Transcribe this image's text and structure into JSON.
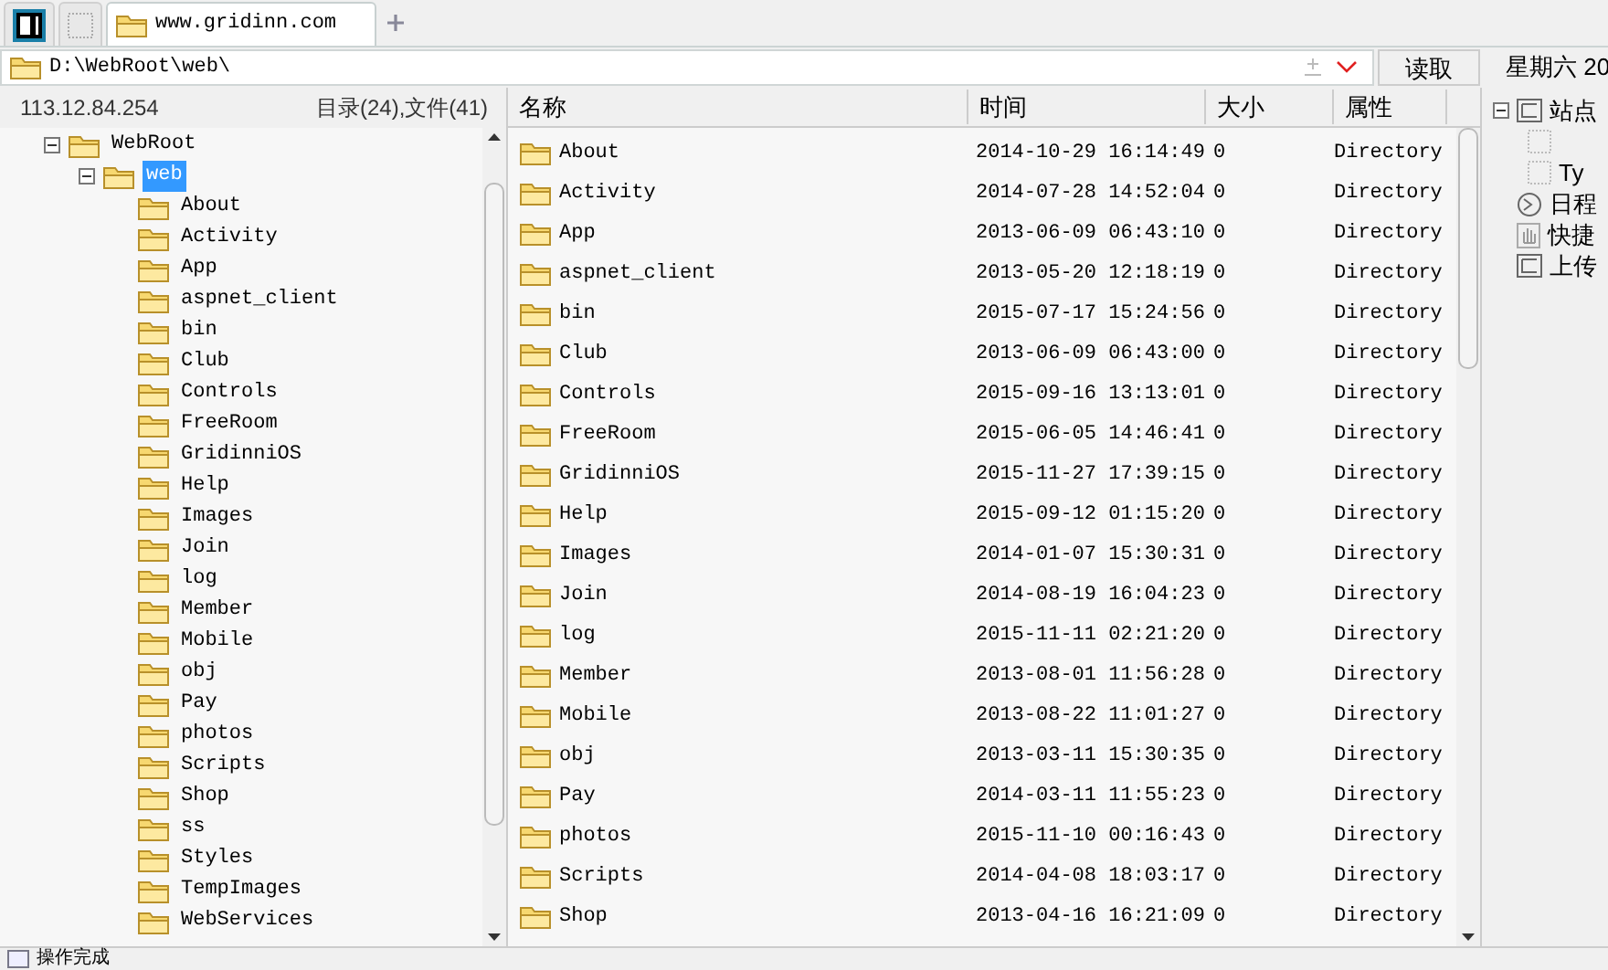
{
  "tabs": [
    {
      "kind": "panel",
      "selected": false
    },
    {
      "kind": "blank",
      "selected": false
    },
    {
      "kind": "site",
      "label": "www.gridinn.com",
      "selected": true
    }
  ],
  "address": {
    "value": "D:\\WebRoot\\web\\",
    "button": "读取"
  },
  "date": "星期六 20",
  "left_header": {
    "host": "113.12.84.254",
    "summary": "目录(24),文件(41)"
  },
  "tree": [
    {
      "label": "WebRoot",
      "expanded": true,
      "selected": false,
      "children": [
        {
          "label": "web",
          "expanded": true,
          "selected": true,
          "children": [
            {
              "label": "About"
            },
            {
              "label": "Activity"
            },
            {
              "label": "App"
            },
            {
              "label": "aspnet_client"
            },
            {
              "label": "bin"
            },
            {
              "label": "Club"
            },
            {
              "label": "Controls"
            },
            {
              "label": "FreeRoom"
            },
            {
              "label": "GridinniOS"
            },
            {
              "label": "Help"
            },
            {
              "label": "Images"
            },
            {
              "label": "Join"
            },
            {
              "label": "log"
            },
            {
              "label": "Member"
            },
            {
              "label": "Mobile"
            },
            {
              "label": "obj"
            },
            {
              "label": "Pay"
            },
            {
              "label": "photos"
            },
            {
              "label": "Scripts"
            },
            {
              "label": "Shop"
            },
            {
              "label": "ss"
            },
            {
              "label": "Styles"
            },
            {
              "label": "TempImages"
            },
            {
              "label": "WebServices"
            }
          ]
        }
      ]
    }
  ],
  "table": {
    "columns": [
      "名称",
      "时间",
      "大小",
      "属性"
    ],
    "rows": [
      [
        "About",
        "2014-10-29 16:14:49",
        "0",
        "Directory"
      ],
      [
        "Activity",
        "2014-07-28 14:52:04",
        "0",
        "Directory"
      ],
      [
        "App",
        "2013-06-09 06:43:10",
        "0",
        "Directory"
      ],
      [
        "aspnet_client",
        "2013-05-20 12:18:19",
        "0",
        "Directory"
      ],
      [
        "bin",
        "2015-07-17 15:24:56",
        "0",
        "Directory"
      ],
      [
        "Club",
        "2013-06-09 06:43:00",
        "0",
        "Directory"
      ],
      [
        "Controls",
        "2015-09-16 13:13:01",
        "0",
        "Directory"
      ],
      [
        "FreeRoom",
        "2015-06-05 14:46:41",
        "0",
        "Directory"
      ],
      [
        "GridinniOS",
        "2015-11-27 17:39:15",
        "0",
        "Directory"
      ],
      [
        "Help",
        "2015-09-12 01:15:20",
        "0",
        "Directory"
      ],
      [
        "Images",
        "2014-01-07 15:30:31",
        "0",
        "Directory"
      ],
      [
        "Join",
        "2014-08-19 16:04:23",
        "0",
        "Directory"
      ],
      [
        "log",
        "2015-11-11 02:21:20",
        "0",
        "Directory"
      ],
      [
        "Member",
        "2013-08-01 11:56:28",
        "0",
        "Directory"
      ],
      [
        "Mobile",
        "2013-08-22 11:01:27",
        "0",
        "Directory"
      ],
      [
        "obj",
        "2013-03-11 15:30:35",
        "0",
        "Directory"
      ],
      [
        "Pay",
        "2014-03-11 11:55:23",
        "0",
        "Directory"
      ],
      [
        "photos",
        "2015-11-10 00:16:43",
        "0",
        "Directory"
      ],
      [
        "Scripts",
        "2014-04-08 18:03:17",
        "0",
        "Directory"
      ],
      [
        "Shop",
        "2013-04-16 16:21:09",
        "0",
        "Directory"
      ]
    ]
  },
  "side_tree": [
    {
      "kind": "group",
      "label": "站点",
      "expanded": true,
      "children": [
        {
          "kind": "blank"
        },
        {
          "kind": "blank",
          "label": "Ty"
        }
      ]
    },
    {
      "kind": "clock",
      "label": "日程"
    },
    {
      "kind": "hand",
      "label": "快捷"
    },
    {
      "kind": "group",
      "label": "上传"
    }
  ],
  "status_bar": "操作完成"
}
